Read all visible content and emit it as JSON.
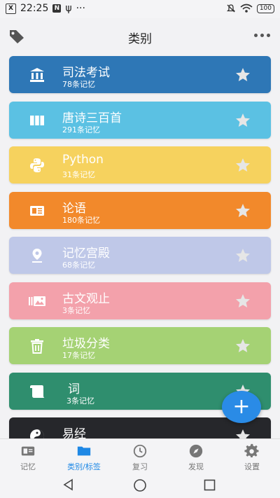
{
  "status_bar": {
    "time": "22:25",
    "icon_x": "X",
    "icon_n": "N",
    "usb": "ψ",
    "dots": "···",
    "battery": "100"
  },
  "header": {
    "title": "类别"
  },
  "categories": [
    {
      "name": "司法考试",
      "count": "78条记忆",
      "color": "#2e77b6",
      "icon": "bank-icon",
      "starred": false
    },
    {
      "name": "唐诗三百首",
      "count": "291条记忆",
      "color": "#5bc1e3",
      "icon": "book-columns-icon",
      "starred": false
    },
    {
      "name": "Python",
      "count": "31条记忆",
      "color": "#f6d25e",
      "icon": "python-icon",
      "starred": false
    },
    {
      "name": "论语",
      "count": "180条记忆",
      "color": "#f2892b",
      "icon": "newspaper-icon",
      "starred": false
    },
    {
      "name": "记忆宫殿",
      "count": "68条记忆",
      "color": "#bfc8e8",
      "icon": "location-pin-icon",
      "starred": false
    },
    {
      "name": "古文观止",
      "count": "3条记忆",
      "color": "#f3a1ab",
      "icon": "photo-film-icon",
      "starred": false
    },
    {
      "name": "垃圾分类",
      "count": "17条记忆",
      "color": "#a5d274",
      "icon": "trash-icon",
      "starred": false
    },
    {
      "name": "词",
      "count": "3条记忆",
      "color": "#2f8e6e",
      "icon": "scroll-icon",
      "starred": false
    },
    {
      "name": "易经",
      "count": "",
      "color": "#26272b",
      "icon": "yin-yang-icon",
      "starred": false
    }
  ],
  "fab": {
    "label": "+"
  },
  "bottom_nav": [
    {
      "label": "记忆",
      "icon": "card-icon",
      "active": false
    },
    {
      "label": "类别/标签",
      "icon": "folder-icon",
      "active": true
    },
    {
      "label": "复习",
      "icon": "clock-icon",
      "active": false
    },
    {
      "label": "发现",
      "icon": "compass-icon",
      "active": false
    },
    {
      "label": "设置",
      "icon": "gear-icon",
      "active": false
    }
  ]
}
